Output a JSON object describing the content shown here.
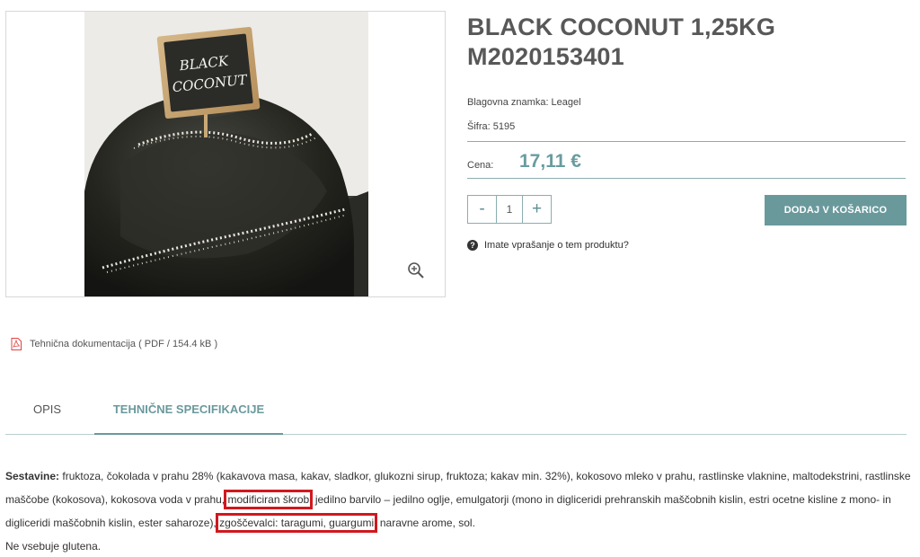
{
  "product": {
    "title": "BLACK COCONUT 1,25KG M2020153401",
    "brand": "Blagovna znamka: Leagel",
    "code": "Šifra: 5195",
    "price_label": "Cena:",
    "price_value": "17,11 €",
    "image_sign_text": [
      "BLACK",
      "COCONUT"
    ]
  },
  "cart": {
    "minus_label": "-",
    "quantity": "1",
    "plus_label": "+",
    "add_label": "DODAJ V KOŠARICO"
  },
  "question_label": "Imate vprašanje o tem produktu?",
  "document_label": "Tehnična dokumentacija ( PDF / 154.4 kB )",
  "tabs": {
    "opis": "OPIS",
    "tehnicne": "TEHNIČNE SPECIFIKACIJE"
  },
  "spec": {
    "label": "Sestavine:",
    "text_1": " fruktoza, čokolada v prahu 28% (kakavova masa, kakav, sladkor, glukozni sirup, fruktoza; kakav min. 32%), kokosovo mleko v prahu, rastlinske vlaknine, maltodekstrini, rastlinske maščobe (kokosova), kokosova voda v prahu, ",
    "highlight_1": "modificiran škrob",
    "text_2": ", jedilno barvilo – jedilno oglje, emulgatorji (mono in digliceridi prehranskih maščobnih kislin, estri ocetne kisline z mono- in digliceridi maščobnih kislin, ester saharoze), ",
    "highlight_2": "zgoščevalci: taragumi, guargumi",
    "text_3": ", naravne arome, sol.",
    "gluten_note": "Ne vsebuje glutena."
  },
  "colors": {
    "accent": "#6a999c",
    "highlight_box": "#d0181f",
    "title": "#585858"
  },
  "icons": [
    "zoom-in-icon",
    "question-circle-icon",
    "pdf-file-icon"
  ]
}
